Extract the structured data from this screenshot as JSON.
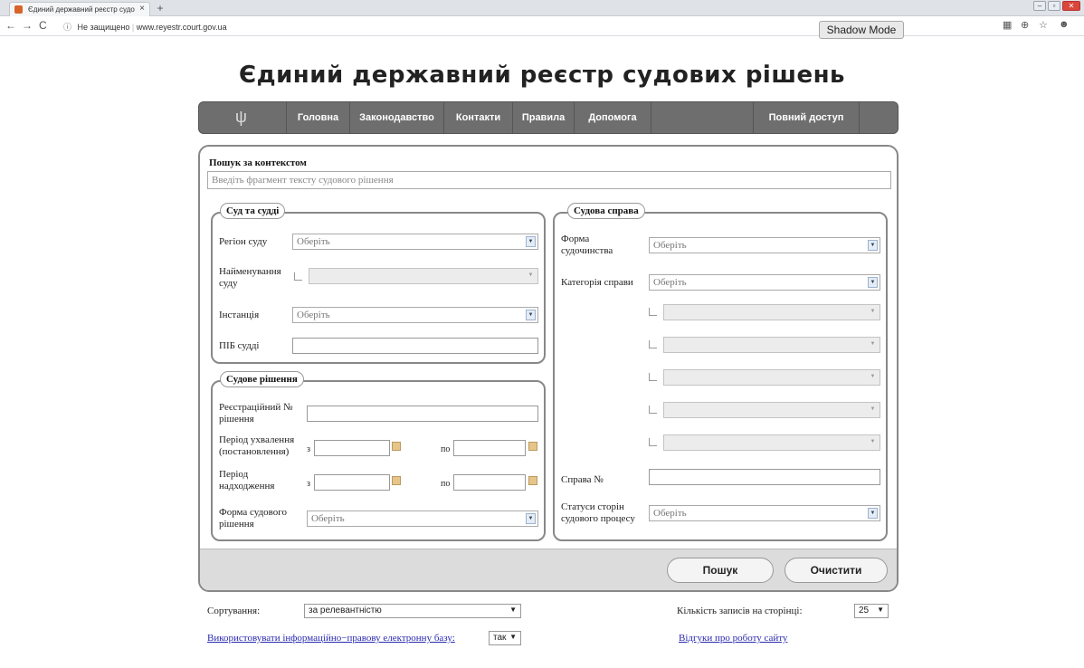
{
  "browser": {
    "tab_title": "Єдиний державний реєстр судо",
    "tab_close": "×",
    "new_tab": "+",
    "url_warning": "Не защищено",
    "url": "www.reyestr.court.gov.ua",
    "shadow_mode": "Shadow Mode"
  },
  "page": {
    "title": "Єдиний державний реєстр судових рішень"
  },
  "menu": {
    "items": [
      "Головна",
      "Законодавство",
      "Контакти",
      "Правила",
      "Допомога",
      "Повний доступ"
    ]
  },
  "search": {
    "context_label": "Пошук за контекстом",
    "context_placeholder": "Введіть фрагмент тексту судового рішення",
    "court": {
      "legend": "Суд та судді",
      "region_label": "Регіон суду",
      "region_value": "Оберіть",
      "name_label": "Найменування суду",
      "instance_label": "Інстанція",
      "instance_value": "Оберіть",
      "judge_label": "ПІБ судді"
    },
    "decision": {
      "legend": "Судове рішення",
      "reg_label": "Реєстраційний № рішення",
      "adopt_label": "Період ухвалення (постановлення)",
      "receipt_label": "Період надходження",
      "from": "з",
      "to": "по",
      "form_label": "Форма судового рішення",
      "form_value": "Оберіть"
    },
    "case": {
      "legend": "Судова справа",
      "justice_label": "Форма судочинства",
      "justice_value": "Оберіть",
      "category_label": "Категорія справи",
      "category_value": "Оберіть",
      "case_no_label": "Справа №",
      "party_label": "Статуси сторін судового процесу",
      "party_value": "Оберіть"
    },
    "search_button": "Пошук",
    "clear_button": "Очистити"
  },
  "bottom": {
    "sort_label": "Сортування:",
    "sort_value": "за релевантністю",
    "per_page_label": "Кількість записів на сторінці:",
    "per_page_value": "25",
    "use_base_link": "Використовувати інформаційно−правову електронну базу:",
    "use_base_value": "так",
    "feedback_link": "Відгуки про роботу сайту"
  }
}
